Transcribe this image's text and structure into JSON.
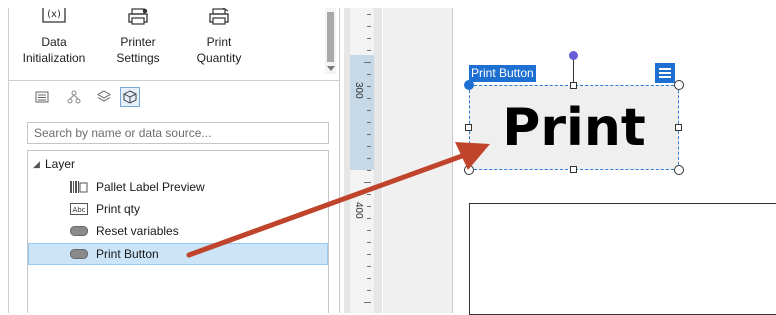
{
  "toolbar": {
    "buttons": [
      {
        "id": "data-init",
        "lines": [
          "Data",
          "Initialization"
        ],
        "icon": "variable-icon"
      },
      {
        "id": "printer-settings",
        "lines": [
          "Printer",
          "Settings"
        ],
        "icon": "printer-settings-icon"
      },
      {
        "id": "print-quantity",
        "lines": [
          "Print",
          "Quantity"
        ],
        "icon": "print-quantity-icon"
      }
    ]
  },
  "panel": {
    "tabs": [
      "list-icon",
      "hierarchy-icon",
      "layers-icon",
      "object-icon"
    ],
    "active_tab": 3,
    "search": {
      "placeholder": "Search by name or data source...",
      "value": ""
    },
    "tree": {
      "root": "Layer",
      "items": [
        {
          "label": "Pallet Label Preview",
          "icon": "barcode-icon"
        },
        {
          "label": "Print qty",
          "icon": "text-field-icon",
          "icon_text": "Abc"
        },
        {
          "label": "Reset variables",
          "icon": "button-icon"
        },
        {
          "label": "Print Button",
          "icon": "button-icon",
          "selected": true
        }
      ]
    }
  },
  "ruler": {
    "labels": [
      "300",
      "400"
    ]
  },
  "canvas": {
    "selected_object": {
      "tag": "Print Button",
      "text": "Print"
    },
    "accent": "#1e6fd2",
    "arrow_color": "#c0442c"
  }
}
